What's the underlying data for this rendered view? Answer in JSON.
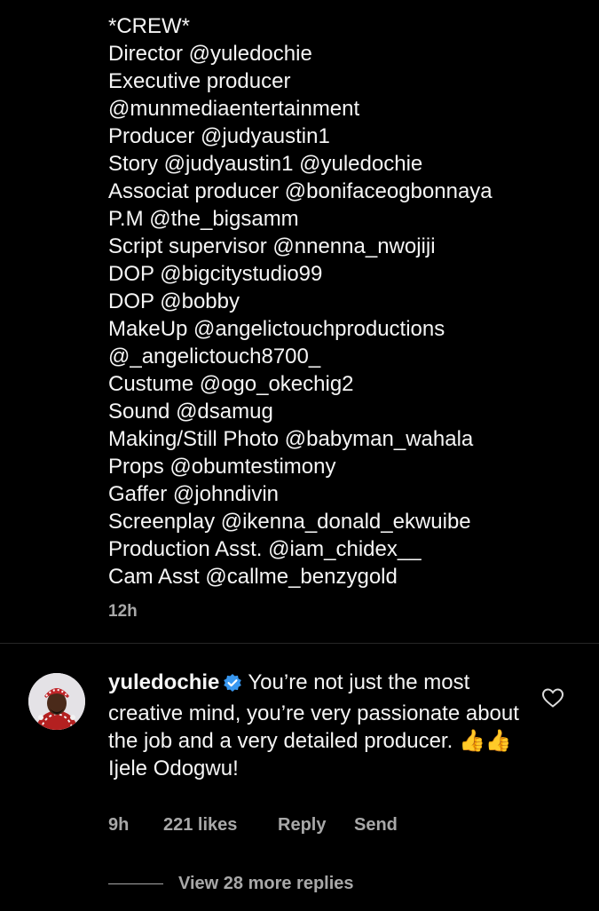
{
  "caption": {
    "lines": [
      "*CREW*",
      "Director @yuledochie",
      "Executive producer",
      "@munmediaentertainment",
      "Producer @judyaustin1",
      "Story  @judyaustin1 @yuledochie",
      "Associat producer @bonifaceogbonnaya",
      "P.M @the_bigsamm",
      "Script supervisor @nnenna_nwojiji",
      "DOP @bigcitystudio99",
      "DOP @bobby",
      "MakeUp @angelictouchproductions",
      "@_angelictouch8700_",
      "Custume @ogo_okechig2",
      "Sound @dsamug",
      "Making/Still Photo @babyman_wahala",
      "Props @obumtestimony",
      "Gaffer @johndivin",
      "Screenplay @ikenna_donald_ekwuibe",
      "Production Asst. @iam_chidex__",
      "Cam Asst @callme_benzygold"
    ],
    "time": "12h"
  },
  "comment": {
    "username": "yuledochie",
    "text_first": "You’re not just the most creative mind, you’re very passionate about the job and a very detailed producer.",
    "emoji": "👍👍",
    "text_second": "Ijele Odogwu!",
    "time": "9h",
    "likes": "221 likes",
    "reply_label": "Reply",
    "send_label": "Send",
    "view_replies": "View 28 more replies"
  },
  "icons": {
    "verified": "verified-badge-icon",
    "like": "heart-outline-icon"
  },
  "colors": {
    "background": "#000000",
    "text": "#f5f5f5",
    "secondary_text": "#a8a8a8",
    "verified": "#3897f0"
  }
}
